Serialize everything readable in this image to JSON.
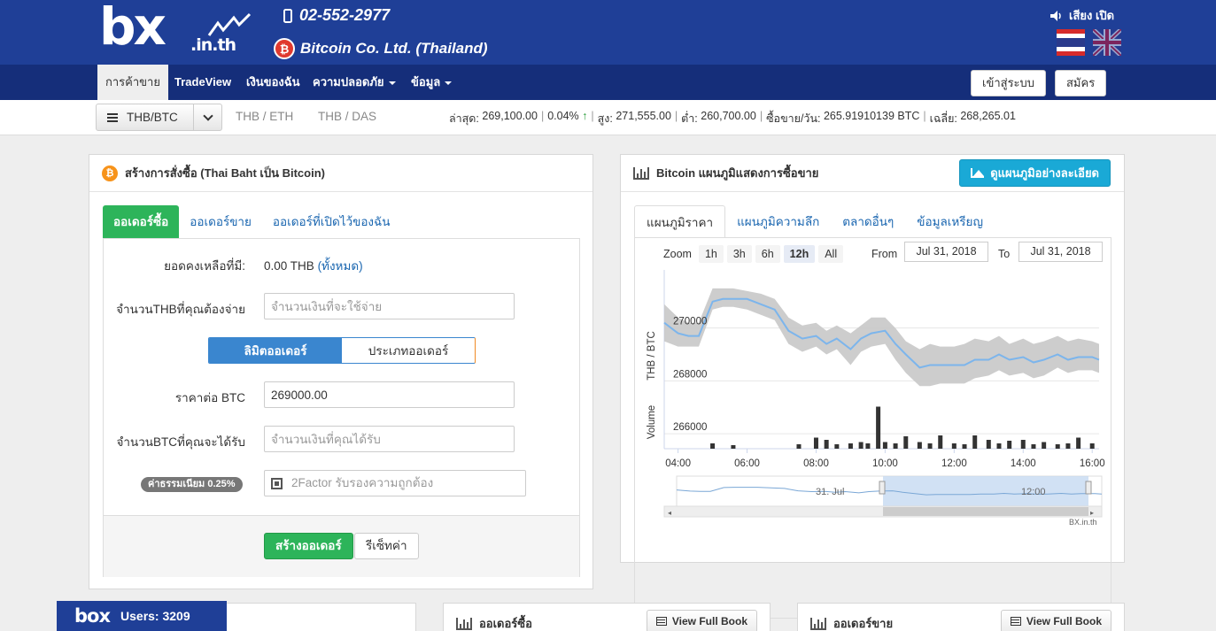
{
  "header": {
    "logo_main": "bx",
    "logo_sub": ".in.th",
    "phone": "02-552-2977",
    "company": "Bitcoin Co. Ltd. (Thailand)",
    "sound_label": "เสียง เปิด"
  },
  "nav": {
    "items": [
      {
        "label": "การค้าขาย",
        "active": true
      },
      {
        "label": "TradeView"
      },
      {
        "label": "เงินของฉัน"
      },
      {
        "label": "ความปลอดภัย",
        "dropdown": true
      },
      {
        "label": "ข้อมูล",
        "dropdown": true
      }
    ],
    "login_label": "เข้าสู่ระบบ",
    "signup_label": "สมัคร"
  },
  "ticker": {
    "selected_pair": "THB/BTC",
    "other_pairs": [
      "THB / ETH",
      "THB / DAS"
    ],
    "last_label": "ล่าสุด:",
    "last_value": "269,100.00",
    "change": "0.04%",
    "high_label": "สูง:",
    "high_value": "271,555.00",
    "low_label": "ต่ำ:",
    "low_value": "260,700.00",
    "volume_label": "ซื้อขาย/วัน:",
    "volume_value": "265.91910139 BTC",
    "avg_label": "เฉลี่ย:",
    "avg_value": "268,265.01"
  },
  "order_form": {
    "title": "สร้างการสั่งซื้อ (Thai Baht เป็น Bitcoin)",
    "tabs": [
      "ออเดอร์ซื้อ",
      "ออเดอร์ขาย",
      "ออเดอร์ที่เปิดไว้ของฉัน"
    ],
    "balance_label": "ยอดคงเหลือที่มี:",
    "balance_value": "0.00 THB",
    "balance_all": "(ทั้งหมด)",
    "thb_label": "จำนวนTHBที่คุณต้องจ่าย",
    "thb_placeholder": "จำนวนเงินที่จะใช้จ่าย",
    "order_type_limit": "ลิมิตออเดอร์",
    "order_type_other": "ประเภทออเดอร์",
    "price_label": "ราคาต่อ BTC",
    "price_value": "269000.00",
    "btc_label": "จำนวนBTCที่คุณจะได้รับ",
    "btc_placeholder": "จำนวนเงินที่คุณได้รับ",
    "fee_badge": "ค่าธรรมเนียม 0.25%",
    "twofactor_placeholder": "2Factor รับรองความถูกต้อง",
    "submit_label": "สร้างออเดอร์",
    "reset_label": "รีเซ็ทค่า"
  },
  "chart_panel": {
    "title": "Bitcoin แผนภูมิแสดงการซื้อขาย",
    "detail_button": "ดูแผนภูมิอย่างละเอียด",
    "tabs": [
      "แผนภูมิราคา",
      "แผนภูมิความลึก",
      "ตลาดอื่นๆ",
      "ข้อมูลเหรียญ"
    ],
    "zoom_label": "Zoom",
    "zoom_options": [
      "1h",
      "3h",
      "6h",
      "12h",
      "All"
    ],
    "zoom_selected": "12h",
    "from_label": "From",
    "from_value": "Jul 31, 2018",
    "to_label": "To",
    "to_value": "Jul 31, 2018",
    "navigator_labels": [
      "31. Jul",
      "12:00"
    ],
    "credit": "BX.in.th"
  },
  "chart_data": {
    "type": "line",
    "ylabel": "THB / BTC",
    "volume_label": "Volume",
    "ytick_labels": [
      "270000",
      "268000",
      "266000"
    ],
    "yticks": [
      270000,
      268000,
      266000
    ],
    "ylim": [
      265500,
      272200
    ],
    "xtick_labels": [
      "04:00",
      "06:00",
      "08:00",
      "10:00",
      "12:00",
      "14:00",
      "16:00"
    ],
    "xtick_hours": [
      4,
      6,
      8,
      10,
      12,
      14,
      16
    ],
    "xlim_hours": [
      3.6,
      16.2
    ],
    "series": [
      {
        "x_hours": [
          3.6,
          4.0,
          4.3,
          4.6,
          5.0,
          5.3,
          5.6,
          6.0,
          6.4,
          6.8,
          7.2,
          7.6,
          8.0,
          8.3,
          8.6,
          9.0,
          9.3,
          9.6,
          10.0,
          10.3,
          10.6,
          11.0,
          11.3,
          11.6,
          12.0,
          12.3,
          12.6,
          13.0,
          13.3,
          13.6,
          14.0,
          14.3,
          14.6,
          15.0,
          15.3,
          15.6,
          16.0,
          16.2
        ],
        "price": [
          270200,
          269800,
          269700,
          269700,
          271000,
          271100,
          271100,
          271100,
          270900,
          270700,
          269900,
          269600,
          269700,
          269400,
          269600,
          269200,
          269600,
          269800,
          269900,
          269400,
          269000,
          268500,
          268600,
          268600,
          268600,
          268600,
          268800,
          268800,
          269000,
          268800,
          268900,
          268700,
          268800,
          269000,
          268800,
          268900,
          268900,
          268800
        ],
        "band_low": [
          269500,
          269300,
          269300,
          269300,
          270700,
          270800,
          270800,
          270700,
          270500,
          270300,
          269400,
          269100,
          269300,
          269000,
          269200,
          268600,
          269100,
          269300,
          269400,
          268800,
          268300,
          267800,
          267800,
          267900,
          267900,
          267900,
          268100,
          268200,
          268400,
          268200,
          268300,
          268100,
          268200,
          268500,
          268300,
          268400,
          268400,
          268300
        ],
        "band_high": [
          270900,
          270400,
          270200,
          270200,
          271500,
          271500,
          271500,
          271400,
          271300,
          271100,
          270400,
          270100,
          270200,
          269900,
          270100,
          269800,
          270100,
          270400,
          270400,
          270000,
          269500,
          269200,
          269400,
          269300,
          269300,
          269400,
          269600,
          269500,
          269700,
          269400,
          269600,
          269400,
          269500,
          269700,
          269500,
          269600,
          269500,
          269400
        ]
      }
    ],
    "volume": [
      {
        "x": 5.0,
        "v": 0.12
      },
      {
        "x": 5.6,
        "v": 0.08
      },
      {
        "x": 7.5,
        "v": 0.1
      },
      {
        "x": 8.0,
        "v": 0.25
      },
      {
        "x": 8.3,
        "v": 0.2
      },
      {
        "x": 8.6,
        "v": 0.1
      },
      {
        "x": 9.0,
        "v": 0.12
      },
      {
        "x": 9.3,
        "v": 0.15
      },
      {
        "x": 9.5,
        "v": 0.12
      },
      {
        "x": 9.8,
        "v": 0.95
      },
      {
        "x": 10.0,
        "v": 0.15
      },
      {
        "x": 10.3,
        "v": 0.12
      },
      {
        "x": 10.6,
        "v": 0.28
      },
      {
        "x": 11.0,
        "v": 0.15
      },
      {
        "x": 11.3,
        "v": 0.12
      },
      {
        "x": 11.6,
        "v": 0.3
      },
      {
        "x": 12.0,
        "v": 0.12
      },
      {
        "x": 12.3,
        "v": 0.1
      },
      {
        "x": 12.6,
        "v": 0.3
      },
      {
        "x": 13.0,
        "v": 0.2
      },
      {
        "x": 13.3,
        "v": 0.12
      },
      {
        "x": 13.6,
        "v": 0.18
      },
      {
        "x": 14.0,
        "v": 0.2
      },
      {
        "x": 14.3,
        "v": 0.1
      },
      {
        "x": 14.6,
        "v": 0.15
      },
      {
        "x": 15.0,
        "v": 0.1
      },
      {
        "x": 15.3,
        "v": 0.12
      },
      {
        "x": 15.6,
        "v": 0.25
      },
      {
        "x": 16.0,
        "v": 0.12
      }
    ]
  },
  "bottom": {
    "chat_logo": "box",
    "users_label": "Users: 3209",
    "buy_orders_title": "ออเดอร์ซื้อ",
    "sell_orders_title": "ออเดอร์ขาย",
    "view_full_book": "View Full Book"
  }
}
